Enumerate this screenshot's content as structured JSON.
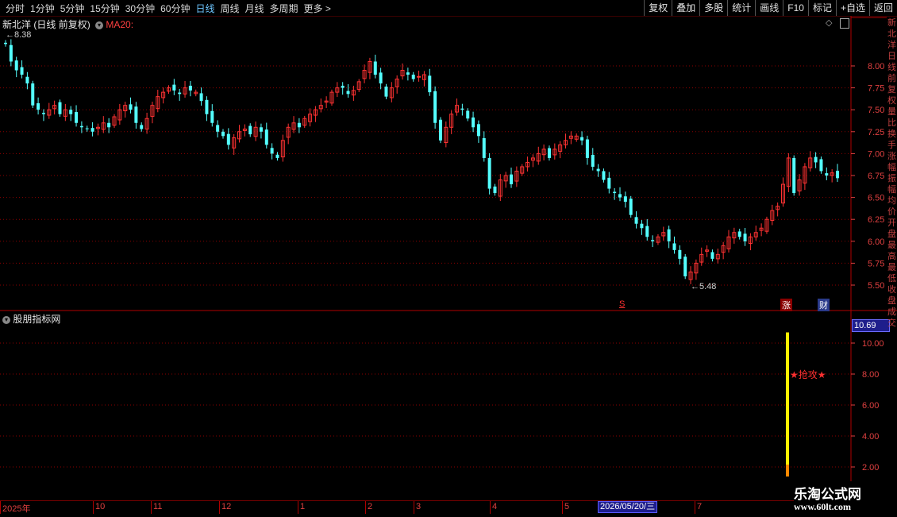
{
  "toolbar": {
    "periods": [
      "分时",
      "1分钟",
      "5分钟",
      "15分钟",
      "30分钟",
      "60分钟",
      "日线",
      "周线",
      "月线",
      "多周期",
      "更多 >"
    ],
    "active_period": "日线",
    "right_buttons": [
      "复权",
      "叠加",
      "多股",
      "统计",
      "画线",
      "F10",
      "标记",
      "+自选",
      "返回"
    ]
  },
  "main_chart": {
    "stock_name": "新北洋",
    "mode": "(日线 前复权)",
    "indicator_label": "MA20:",
    "high_note": "8.38",
    "low_note": "5.48",
    "markers": {
      "s": "S",
      "zhang": "涨",
      "cai": "财"
    },
    "colors": {
      "up": "#ff3232",
      "down": "#54ffff",
      "grid": "#8b0000",
      "axis": "#e04040"
    }
  },
  "sub_chart": {
    "title": "股朋指标网",
    "current_value": "10.69",
    "signal_text": "★抢攻★"
  },
  "timeline": {
    "labels": [
      "2025年",
      "10",
      "11",
      "12",
      "1",
      "2",
      "3",
      "4",
      "5",
      "7"
    ],
    "cursor_date": "2026/05/20/三"
  },
  "watermark": {
    "line1": "乐淘公式网",
    "line2": "www.60lt.com"
  },
  "chart_data": [
    {
      "type": "candlestick",
      "title": "新北洋 (日线 前复权)",
      "y_ticks": [
        "8.00",
        "7.75",
        "7.50",
        "7.25",
        "7.00",
        "6.75",
        "6.50",
        "6.25",
        "6.00",
        "5.75",
        "5.50"
      ],
      "ylim": [
        5.4,
        8.4
      ],
      "x_labels": [
        "2025年",
        "10",
        "11",
        "12",
        "1",
        "2",
        "3",
        "4",
        "5",
        "7"
      ],
      "close": [
        8.25,
        8.05,
        7.95,
        7.9,
        7.8,
        7.55,
        7.5,
        7.45,
        7.5,
        7.55,
        7.45,
        7.5,
        7.45,
        7.35,
        7.3,
        7.28,
        7.25,
        7.3,
        7.35,
        7.3,
        7.42,
        7.5,
        7.55,
        7.5,
        7.35,
        7.28,
        7.4,
        7.55,
        7.65,
        7.7,
        7.75,
        7.72,
        7.68,
        7.75,
        7.72,
        7.7,
        7.6,
        7.45,
        7.35,
        7.25,
        7.2,
        7.1,
        7.18,
        7.25,
        7.28,
        7.22,
        7.3,
        7.25,
        7.1,
        7.0,
        6.95,
        7.15,
        7.3,
        7.35,
        7.3,
        7.4,
        7.45,
        7.5,
        7.55,
        7.6,
        7.7,
        7.75,
        7.75,
        7.68,
        7.72,
        7.82,
        7.95,
        8.05,
        7.9,
        7.8,
        7.65,
        7.75,
        7.85,
        7.95,
        7.9,
        7.85,
        7.88,
        7.9,
        7.7,
        7.35,
        7.15,
        7.3,
        7.45,
        7.55,
        7.5,
        7.4,
        7.3,
        7.2,
        6.95,
        6.6,
        6.55,
        6.7,
        6.75,
        6.65,
        6.8,
        6.85,
        6.9,
        6.95,
        7.0,
        7.05,
        6.95,
        7.05,
        7.1,
        7.15,
        7.2,
        7.2,
        7.15,
        6.95,
        6.85,
        6.8,
        6.7,
        6.6,
        6.55,
        6.5,
        6.45,
        6.3,
        6.2,
        6.15,
        6.05,
        6.0,
        6.05,
        6.1,
        6.0,
        5.9,
        5.8,
        5.6,
        5.65,
        5.75,
        5.85,
        5.9,
        5.8,
        5.85,
        5.95,
        6.05,
        6.1,
        6.05,
        6.0,
        6.05,
        6.1,
        6.15,
        6.25,
        6.35,
        6.4,
        6.65,
        6.95,
        6.55,
        6.7,
        6.85,
        6.95,
        6.9,
        6.8,
        6.75,
        6.78,
        6.72
      ],
      "series": [
        {
          "name": "MA20",
          "values": []
        }
      ]
    },
    {
      "type": "bar",
      "title": "股朋指标网",
      "y_ticks": [
        "10.00",
        "8.00",
        "6.00",
        "4.00",
        "2.00"
      ],
      "ylim": [
        1.9,
        11.2
      ],
      "categories": [
        "2026/05/20"
      ],
      "values": [
        10.69
      ]
    }
  ]
}
